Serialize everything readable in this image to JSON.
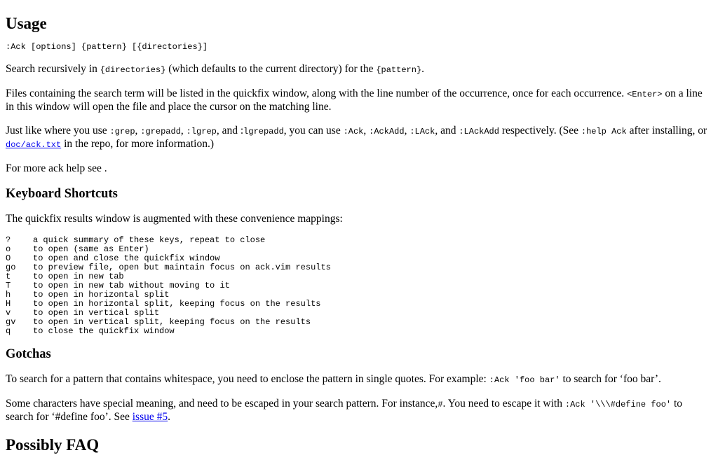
{
  "usage": {
    "heading": "Usage",
    "synopsis": ":Ack [options] {pattern} [{directories}]",
    "p1": {
      "t1": "Search recursively in ",
      "c1": "{directories}",
      "t2": " (which defaults to the current directory) for the ",
      "c2": "{pattern}",
      "t3": "."
    },
    "p2": {
      "t1": "Files containing the search term will be listed in the quickfix window, along with the line number of the occurrence, once for each occurrence. ",
      "c1": "<Enter>",
      "t2": " on a line in this window will open the file and place the cursor on the matching line."
    },
    "p3": {
      "t1": "Just like where you use ",
      "c1": ":grep",
      "t2": ", ",
      "c2": ":grepadd",
      "t3": ", ",
      "c3": ":lgrep",
      "t4": ", and :",
      "c4": "lgrepadd",
      "t5": ", you can use ",
      "c5": ":Ack",
      "t6": ", ",
      "c6": ":AckAdd",
      "t7": ", ",
      "c7": ":LAck",
      "t8": ", and ",
      "c8": ":LAckAdd",
      "t9": " respectively. (See ",
      "c9": ":help Ack",
      "t10": " after installing, or ",
      "link": "doc/ack.txt",
      "t11": " in the repo, for more information.)"
    },
    "p4": "For more ack help see ."
  },
  "shortcuts": {
    "heading": "Keyboard Shortcuts",
    "intro": "The quickfix results window is augmented with these convenience mappings:",
    "rows": [
      {
        "key": "?",
        "desc": "a quick summary of these keys, repeat to close"
      },
      {
        "key": "o",
        "desc": "to open (same as Enter)"
      },
      {
        "key": "O",
        "desc": "to open and close the quickfix window"
      },
      {
        "key": "go",
        "desc": "to preview file, open but maintain focus on ack.vim results"
      },
      {
        "key": "t",
        "desc": "to open in new tab"
      },
      {
        "key": "T",
        "desc": "to open in new tab without moving to it"
      },
      {
        "key": "h",
        "desc": "to open in horizontal split"
      },
      {
        "key": "H",
        "desc": "to open in horizontal split, keeping focus on the results"
      },
      {
        "key": "v",
        "desc": "to open in vertical split"
      },
      {
        "key": "gv",
        "desc": "to open in vertical split, keeping focus on the results"
      },
      {
        "key": "q",
        "desc": "to close the quickfix window"
      }
    ]
  },
  "gotchas": {
    "heading": "Gotchas",
    "p1": {
      "t1": "To search for a pattern that contains whitespace, you need to enclose the pattern in single quotes. For example: ",
      "c1": ":Ack 'foo bar'",
      "t2": " to search for ‘foo bar’."
    },
    "p2": {
      "t1": "Some characters have special meaning, and need to be escaped in your search pattern. For instance,",
      "c1": "#",
      "t2": ". You need to escape it with ",
      "c2": ":Ack '\\\\\\#define foo'",
      "t3": " to search for ‘#define foo’. See ",
      "link": "issue #5",
      "t4": "."
    }
  },
  "faq": {
    "heading": "Possibly FAQ"
  }
}
